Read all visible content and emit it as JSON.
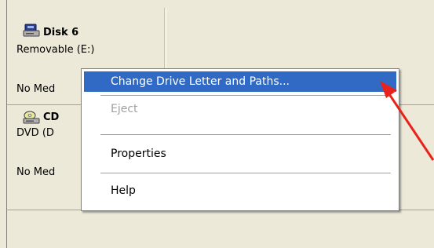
{
  "disks": [
    {
      "name": "Disk 6",
      "type": "Removable (E:)",
      "media": "No Med",
      "icon": "removable-disk-icon"
    },
    {
      "name": "CD",
      "type": "DVD (D",
      "media": "No Med",
      "icon": "cd-drive-icon"
    }
  ],
  "context_menu": {
    "items": [
      {
        "label": "Change Drive Letter and Paths...",
        "state": "highlighted"
      },
      {
        "label": "Eject",
        "state": "disabled"
      },
      {
        "label": "Properties",
        "state": "enabled"
      },
      {
        "label": "Help",
        "state": "enabled"
      }
    ]
  },
  "colors": {
    "highlight": "#316ac5",
    "annotation_arrow": "#e8231c",
    "disabled_text": "#a0a0a0"
  }
}
